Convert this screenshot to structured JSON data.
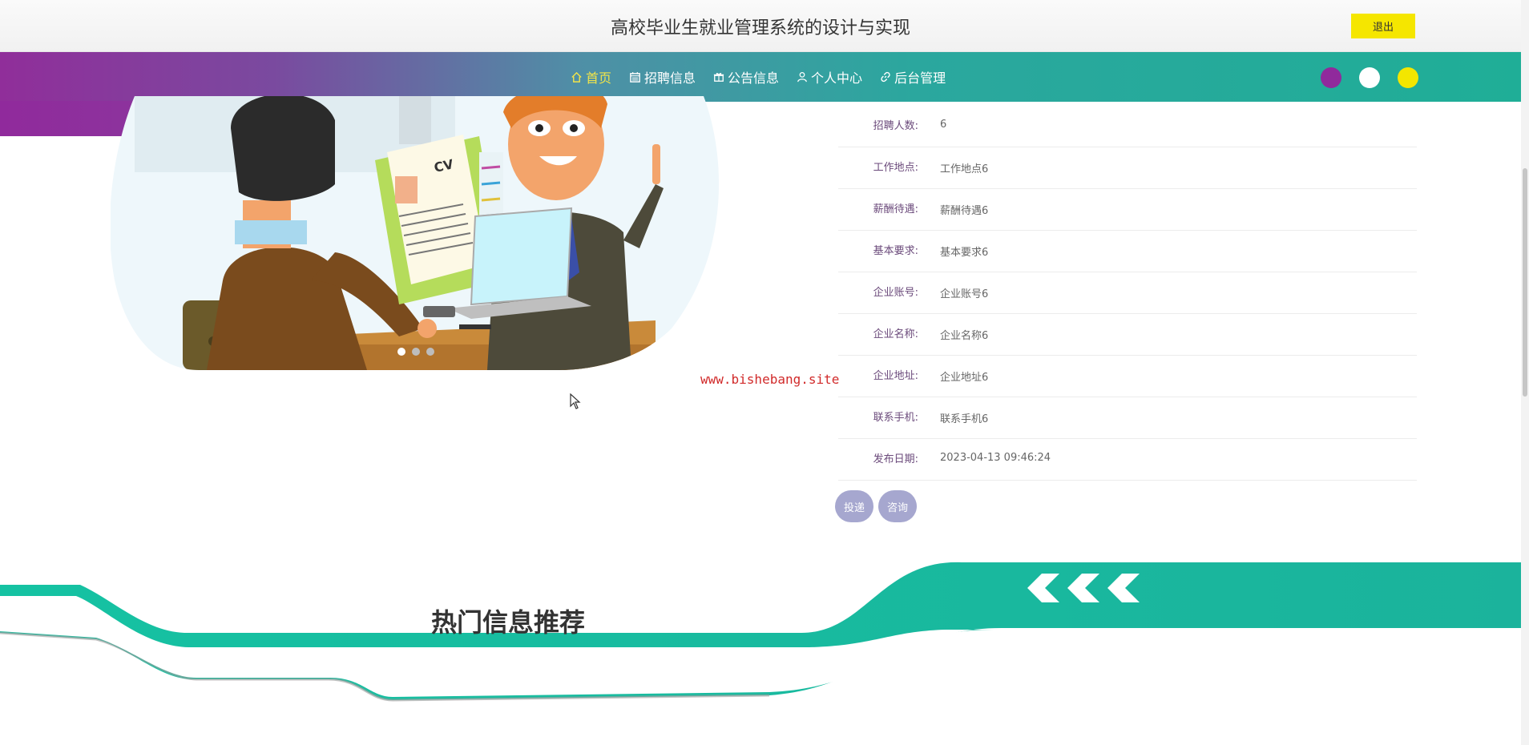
{
  "header": {
    "title": "高校毕业生就业管理系统的设计与实现",
    "logout_label": "退出"
  },
  "nav": {
    "items": [
      {
        "label": "首页",
        "icon": "home-icon",
        "active": true
      },
      {
        "label": "招聘信息",
        "icon": "calendar-icon",
        "active": false
      },
      {
        "label": "公告信息",
        "icon": "gift-icon",
        "active": false
      },
      {
        "label": "个人中心",
        "icon": "user-icon",
        "active": false
      },
      {
        "label": "后台管理",
        "icon": "link-icon",
        "active": false
      }
    ],
    "theme_swatches": [
      "#902a9c",
      "#ffffff",
      "#f3e600"
    ]
  },
  "carousel": {
    "dot_count": 3,
    "active_dot": 1
  },
  "details": {
    "rows": [
      {
        "label": "招聘人数:",
        "value": "6"
      },
      {
        "label": "工作地点:",
        "value": "工作地点6"
      },
      {
        "label": "薪酬待遇:",
        "value": "薪酬待遇6"
      },
      {
        "label": "基本要求:",
        "value": "基本要求6"
      },
      {
        "label": "企业账号:",
        "value": "企业账号6"
      },
      {
        "label": "企业名称:",
        "value": "企业名称6"
      },
      {
        "label": "企业地址:",
        "value": "企业地址6"
      },
      {
        "label": "联系手机:",
        "value": "联系手机6"
      },
      {
        "label": "发布日期:",
        "value": "2023-04-13 09:46:24"
      }
    ],
    "actions": {
      "apply_label": "投递",
      "consult_label": "咨询"
    }
  },
  "watermark": "www.bishebang.site",
  "section": {
    "title": "热门信息推荐"
  },
  "colors": {
    "teal": "#1fb39a",
    "purple": "#902a9c",
    "nav_active": "#f1e44a",
    "button": "#a6a7cf"
  }
}
